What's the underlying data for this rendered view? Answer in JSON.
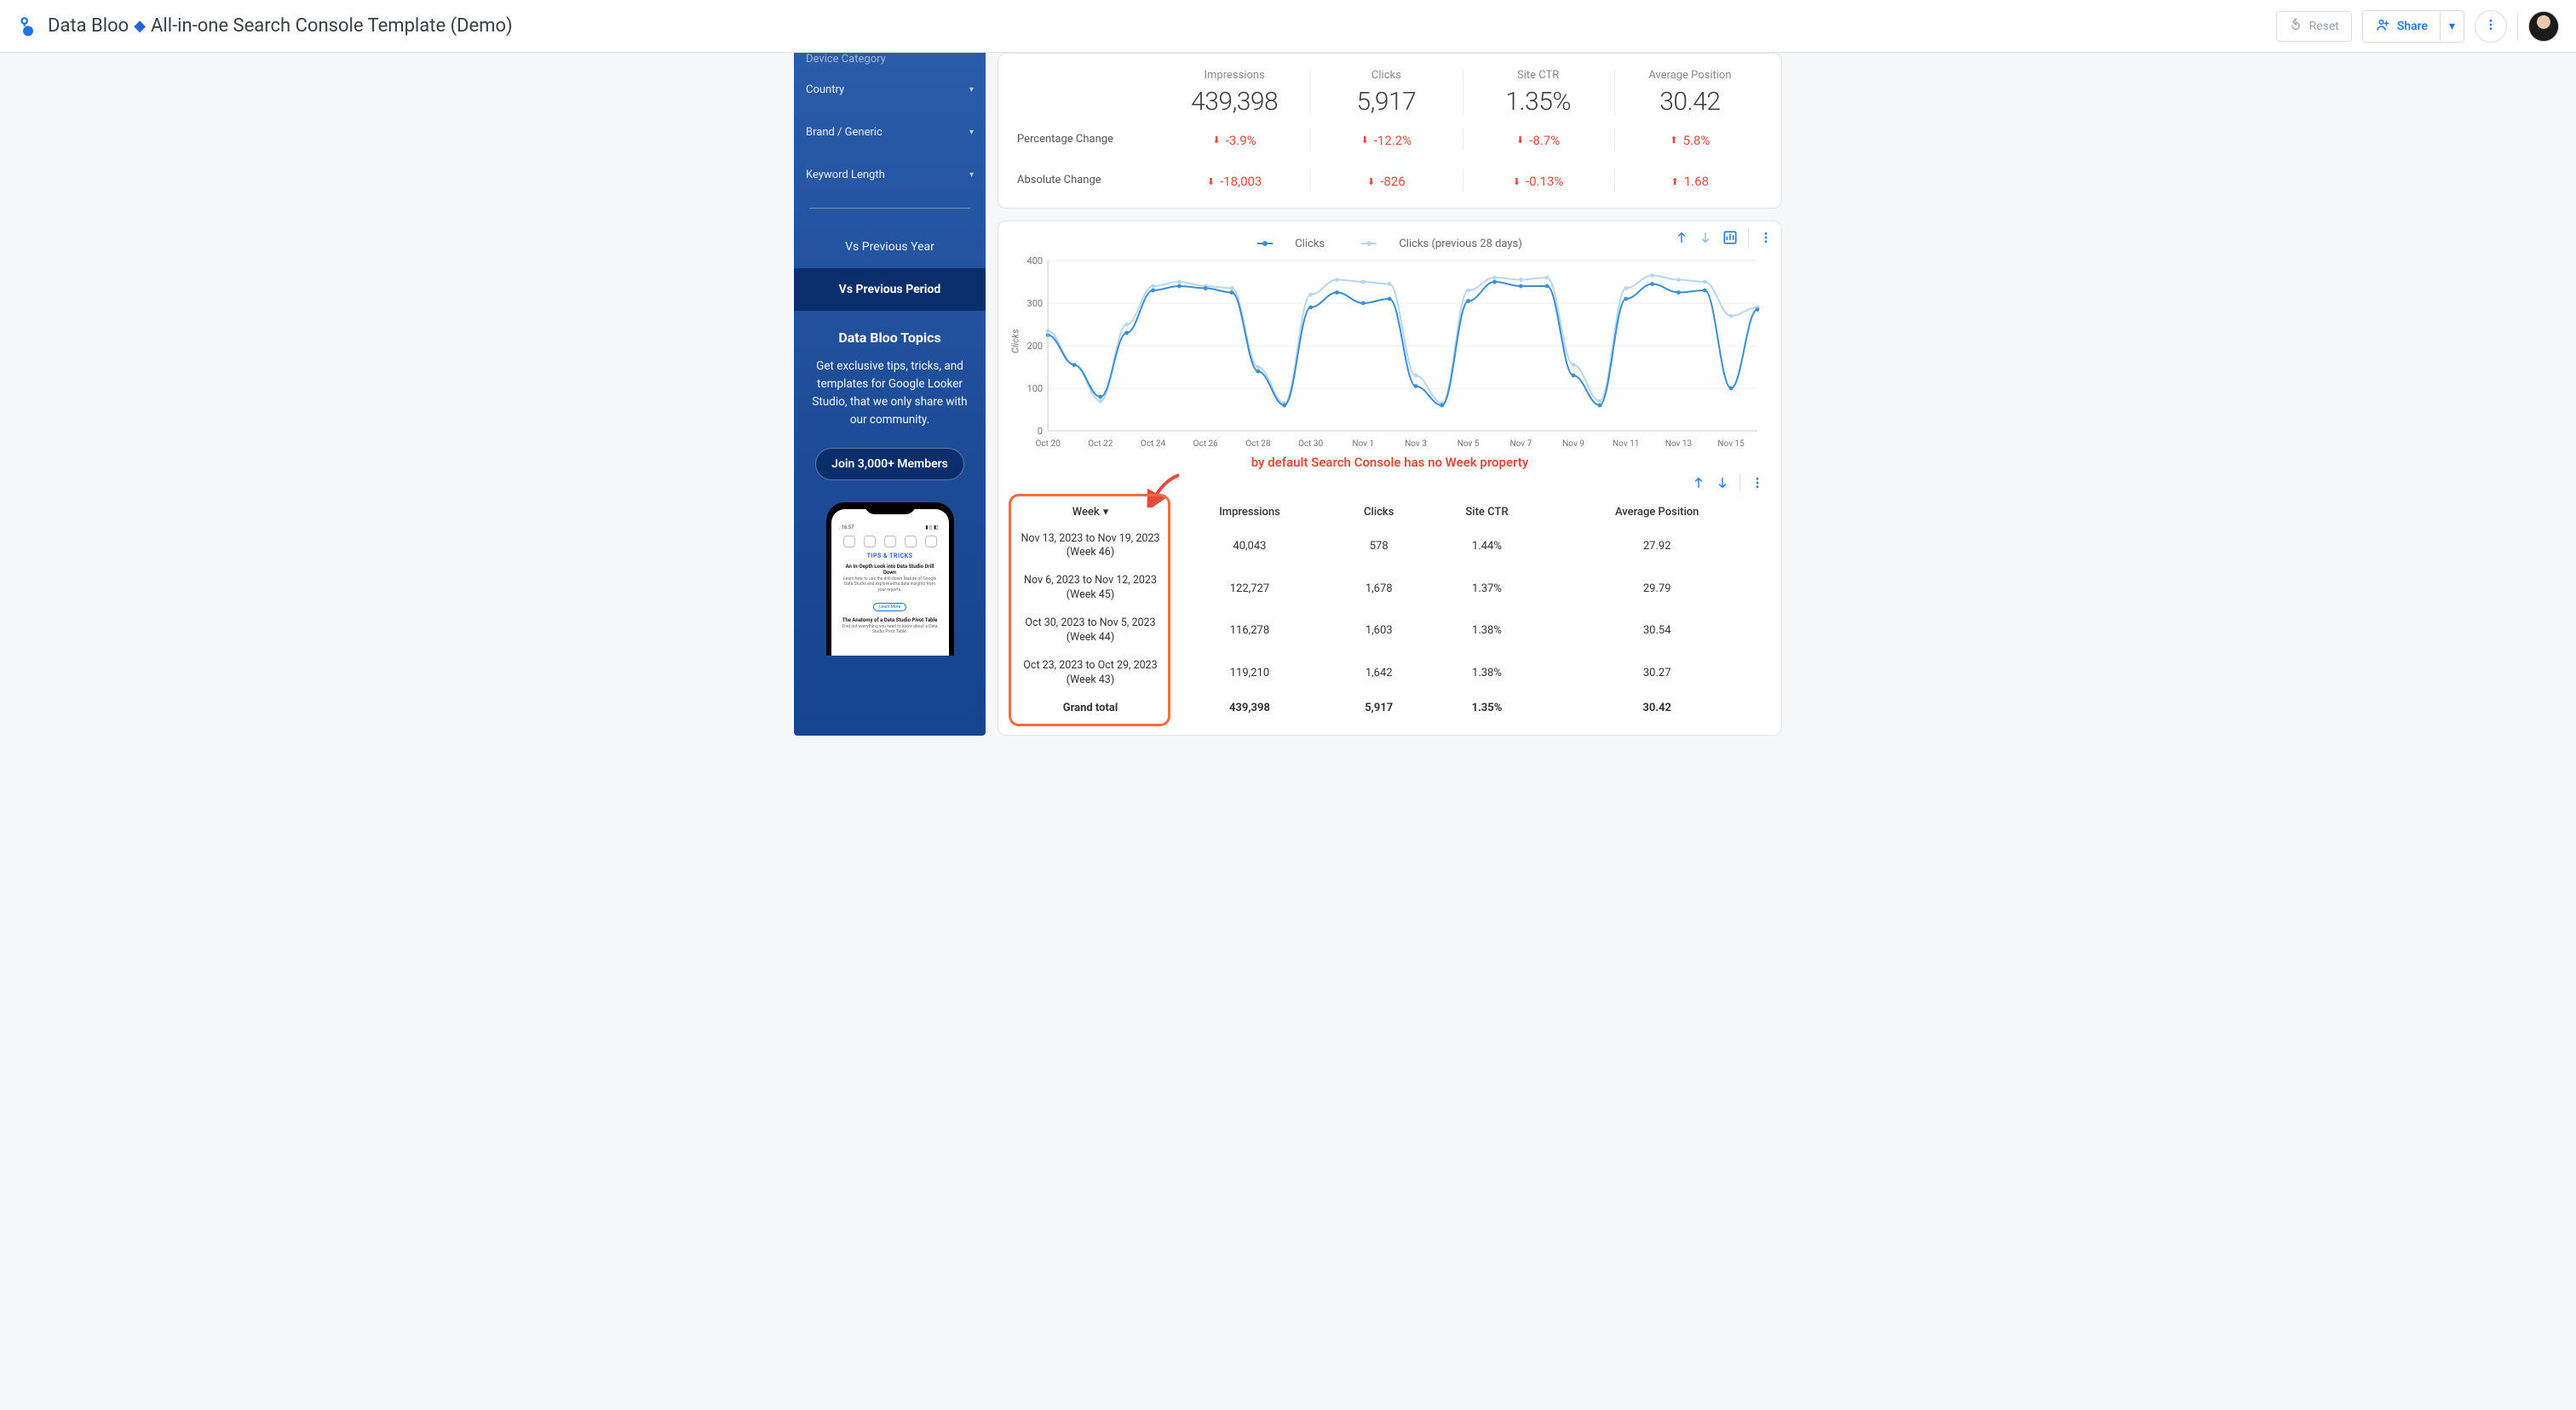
{
  "header": {
    "brand": "Data Bloo",
    "title_sep_glyph": "🔹",
    "title_rest": "All-in-one Search Console Template (Demo)",
    "reset_label": "Reset",
    "share_label": "Share"
  },
  "sidebar": {
    "truncated_top": "Device Category",
    "filters": [
      {
        "label": "Country"
      },
      {
        "label": "Brand / Generic"
      },
      {
        "label": "Keyword Length"
      }
    ],
    "tabs": {
      "prev_year": "Vs Previous Year",
      "prev_period": "Vs Previous Period"
    },
    "topics": {
      "heading": "Data Bloo Topics",
      "body": "Get exclusive tips, tricks, and templates for Google Looker Studio, that we only share with our community.",
      "cta": "Join 3,000+ Members"
    },
    "phone": {
      "time": "16:57",
      "section": "TIPS & TRICKS",
      "a1_title": "An In-Depth Look into Data Studio Drill Down",
      "a1_sub": "Learn how to use the drill-down feature of Google Data Studio and explore extra data insights from your reports.",
      "learn_more": "Learn More",
      "a2_title": "The Anatomy of a Data Studio Pivot Table",
      "a2_sub": "Find out everything you need to know about a Data Studio Pivot Table."
    }
  },
  "kpi": {
    "row_percentage_label": "Percentage Change",
    "row_absolute_label": "Absolute Change",
    "metrics": [
      {
        "label": "Impressions",
        "value": "439,398",
        "pct": "-3.9%",
        "pct_dir": "down",
        "abs": "-18,003",
        "abs_dir": "down"
      },
      {
        "label": "Clicks",
        "value": "5,917",
        "pct": "-12.2%",
        "pct_dir": "down",
        "abs": "-826",
        "abs_dir": "down"
      },
      {
        "label": "Site CTR",
        "value": "1.35%",
        "pct": "-8.7%",
        "pct_dir": "down",
        "abs": "-0.13%",
        "abs_dir": "down"
      },
      {
        "label": "Average Position",
        "value": "30.42",
        "pct": "5.8%",
        "pct_dir": "up",
        "abs": "1.68",
        "abs_dir": "up"
      }
    ]
  },
  "chart_legend": {
    "a": "Clicks",
    "b": "Clicks (previous 28 days)"
  },
  "chart_data": {
    "type": "line",
    "title": "",
    "xlabel": "",
    "ylabel": "Clicks",
    "ylim": [
      0,
      400
    ],
    "yticks": [
      0,
      100,
      200,
      300,
      400
    ],
    "categories": [
      "Oct 20",
      "Oct 22",
      "Oct 24",
      "Oct 26",
      "Oct 28",
      "Oct 30",
      "Nov 1",
      "Nov 3",
      "Nov 5",
      "Nov 7",
      "Nov 9",
      "Nov 11",
      "Nov 13",
      "Nov 15"
    ],
    "series": [
      {
        "name": "Clicks",
        "color": "#3b8fd4",
        "values": [
          225,
          155,
          80,
          230,
          330,
          340,
          335,
          325,
          140,
          60,
          290,
          325,
          300,
          310,
          105,
          60,
          305,
          350,
          340,
          340,
          130,
          60,
          310,
          345,
          325,
          330,
          100,
          285
        ]
      },
      {
        "name": "Clicks (previous 28 days)",
        "color": "#b7d6ef",
        "values": [
          235,
          155,
          70,
          250,
          340,
          350,
          340,
          335,
          150,
          65,
          320,
          355,
          350,
          345,
          130,
          65,
          330,
          360,
          355,
          360,
          155,
          70,
          335,
          365,
          355,
          350,
          270,
          290
        ]
      }
    ]
  },
  "annotation_text": "by default Search Console has no Week property",
  "table": {
    "headers": {
      "week": "Week",
      "impressions": "Impressions",
      "clicks": "Clicks",
      "ctr": "Site CTR",
      "pos": "Average Position"
    },
    "rows": [
      {
        "week_line1": "Nov 13, 2023 to Nov 19, 2023",
        "week_line2": "(Week 46)",
        "impressions": "40,043",
        "clicks": "578",
        "ctr": "1.44%",
        "pos": "27.92"
      },
      {
        "week_line1": "Nov 6, 2023 to Nov 12, 2023",
        "week_line2": "(Week 45)",
        "impressions": "122,727",
        "clicks": "1,678",
        "ctr": "1.37%",
        "pos": "29.79"
      },
      {
        "week_line1": "Oct 30, 2023 to Nov 5, 2023",
        "week_line2": "(Week 44)",
        "impressions": "116,278",
        "clicks": "1,603",
        "ctr": "1.38%",
        "pos": "30.54"
      },
      {
        "week_line1": "Oct 23, 2023 to Oct 29, 2023",
        "week_line2": "(Week 43)",
        "impressions": "119,210",
        "clicks": "1,642",
        "ctr": "1.38%",
        "pos": "30.27"
      }
    ],
    "grand": {
      "label": "Grand total",
      "impressions": "439,398",
      "clicks": "5,917",
      "ctr": "1.35%",
      "pos": "30.42"
    }
  }
}
